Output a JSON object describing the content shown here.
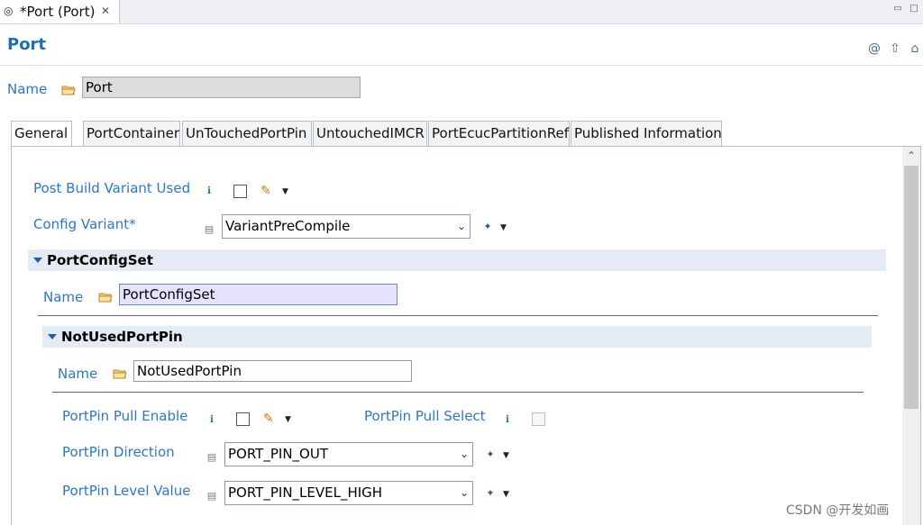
{
  "editor_tab": {
    "label": "*Port (Port)",
    "close": "✕"
  },
  "page": {
    "title": "Port"
  },
  "header_icons": [
    "at-icon",
    "up-arrow-icon",
    "home-icon"
  ],
  "name_row": {
    "label": "Name",
    "value": "Port"
  },
  "tabs": [
    "General",
    "PortContainer",
    "UnTouchedPortPin",
    "UntouchedIMCR",
    "PortEcucPartitionRef",
    "Published Information"
  ],
  "general": {
    "post_build_label": "Post Build Variant Used",
    "config_variant_label": "Config Variant*",
    "config_variant_value": "VariantPreCompile"
  },
  "port_config_set": {
    "title": "PortConfigSet",
    "name_label": "Name",
    "name_value": "PortConfigSet"
  },
  "not_used_port_pin": {
    "title": "NotUsedPortPin",
    "name_label": "Name",
    "name_value": "NotUsedPortPin",
    "pull_enable_label": "PortPin Pull Enable",
    "pull_select_label": "PortPin Pull Select",
    "direction_label": "PortPin Direction",
    "direction_value": "PORT_PIN_OUT",
    "level_label": "PortPin Level Value",
    "level_value": "PORT_PIN_LEVEL_HIGH"
  },
  "watermark": "CSDN @开发如画"
}
